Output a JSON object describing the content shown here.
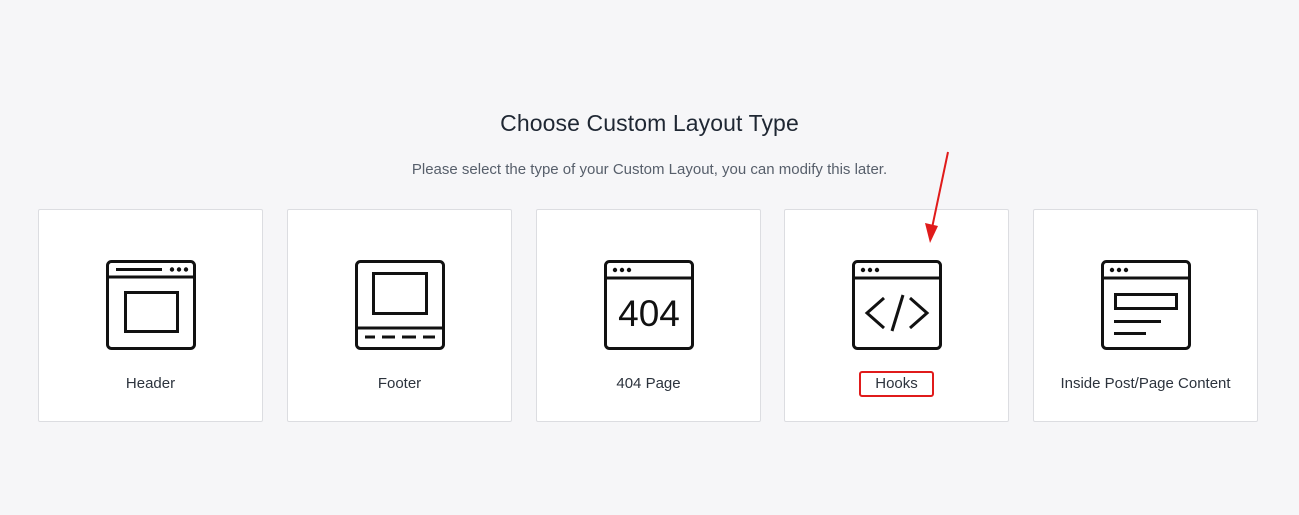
{
  "header": {
    "title": "Choose Custom Layout Type",
    "subtitle": "Please select the type of your Custom Layout, you can modify this later."
  },
  "cards": [
    {
      "label": "Header",
      "icon": "header-layout-icon"
    },
    {
      "label": "Footer",
      "icon": "footer-layout-icon"
    },
    {
      "label": "404 Page",
      "icon": "404-page-icon",
      "icon_text": "404"
    },
    {
      "label": "Hooks",
      "icon": "code-brackets-icon",
      "highlighted": true
    },
    {
      "label": "Inside Post/Page Content",
      "icon": "content-layout-icon"
    }
  ],
  "annotation": {
    "arrow_color": "#e01b1b",
    "highlight_color": "#e01b1b"
  }
}
